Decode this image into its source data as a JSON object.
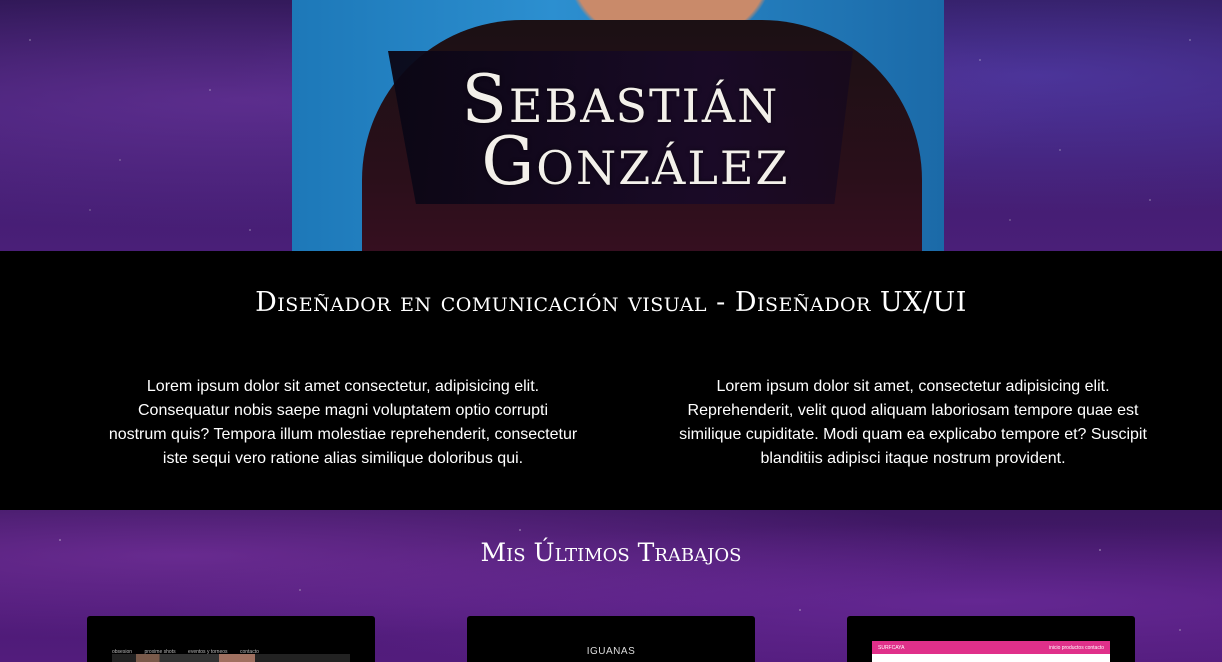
{
  "hero": {
    "name_line1": "Sebastián",
    "name_line2": "González"
  },
  "intro": {
    "title": "Diseñador en comunicación visual - Diseñador UX/UI",
    "left_text": "Lorem ipsum dolor sit amet consectetur, adipisicing elit. Consequatur nobis saepe magni voluptatem optio corrupti nostrum quis? Tempora illum molestiae reprehenderit, consectetur iste sequi vero ratione alias similique doloribus qui.",
    "right_text": "Lorem ipsum dolor sit amet, consectetur adipisicing elit. Reprehenderit, velit quod aliquam laboriosam tempore quae est similique cupiditate. Modi quam ea explicabo tempore et? Suscipit blanditiis adipisci itaque nostrum provident."
  },
  "works": {
    "title": "Mis Últimos Trabajos",
    "cards": [
      {
        "nav": [
          "obsesion",
          "proxime shots",
          "eventos y torneos",
          "contacto"
        ]
      },
      {
        "brand": "IGUANAS"
      },
      {
        "brand_left": "SURFCAYA",
        "nav_right": "inicio  productos  contacto"
      }
    ]
  },
  "colors": {
    "accent_pink": "#e0308a",
    "background_dark": "#000000",
    "space_purple": "#4c1a75"
  }
}
